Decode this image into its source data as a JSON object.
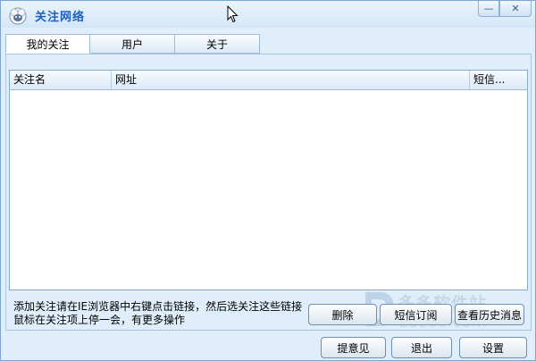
{
  "window": {
    "title": "关注网络"
  },
  "titlebar": {
    "minimize_glyph": "—",
    "close_glyph": "✕"
  },
  "tabs": [
    {
      "label": "我的关注",
      "active": true
    },
    {
      "label": "用户",
      "active": false
    },
    {
      "label": "关于",
      "active": false
    }
  ],
  "list": {
    "columns": [
      "关注名",
      "网址",
      "短信..."
    ],
    "rows": []
  },
  "hint": {
    "line1": "添加关注请在IE浏览器中右键点击链接，然后选关注这些链接",
    "line2": "鼠标在关注项上停一会，有更多操作"
  },
  "actions": {
    "delete": "删除",
    "sms_subscribe": "短信订阅",
    "history": "查看历史消息"
  },
  "footer": {
    "feedback": "提意见",
    "exit": "退出",
    "settings": "设置"
  },
  "watermark": {
    "text_cn": "多多软件站",
    "text_url": "ddooo.com"
  },
  "colors": {
    "accent": "#1f5fbf",
    "title_bg": "#d3e7f8",
    "panel_bg": "#dfeefa"
  }
}
